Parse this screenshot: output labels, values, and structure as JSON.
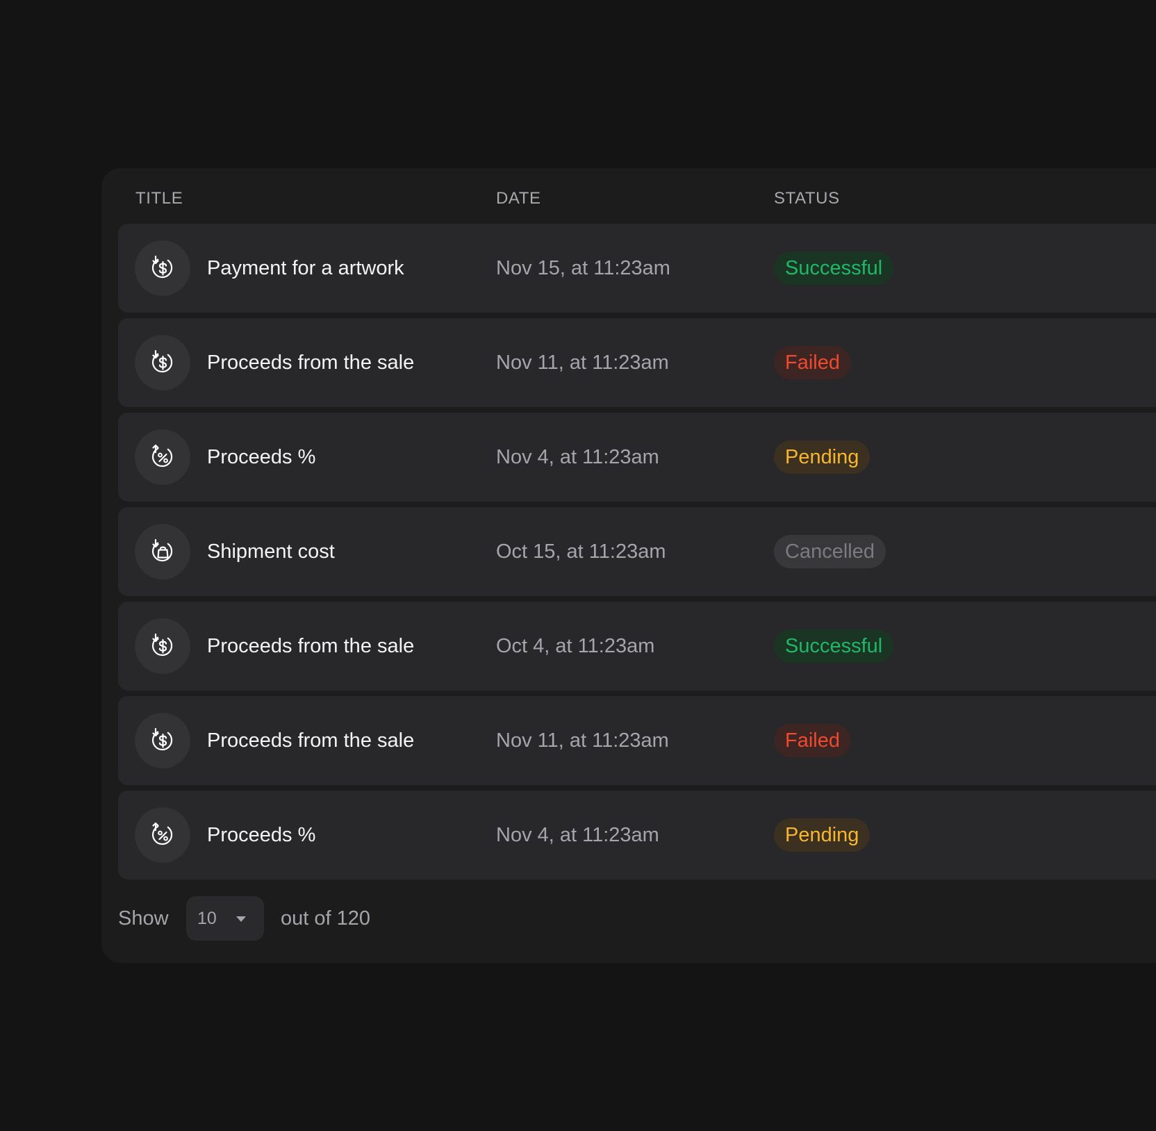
{
  "table": {
    "columns": {
      "title": "TITLE",
      "date": "DATE",
      "status": "STATUS"
    },
    "rows": [
      {
        "icon": "dollar-cycle-icon",
        "title": "Payment for a artwork",
        "date": "Nov 15, at 11:23am",
        "status": "Successful",
        "status_type": "success"
      },
      {
        "icon": "dollar-cycle-icon",
        "title": "Proceeds from the sale",
        "date": "Nov 11, at 11:23am",
        "status": "Failed",
        "status_type": "failed"
      },
      {
        "icon": "percent-cycle-icon",
        "title": "Proceeds %",
        "date": "Nov 4, at 11:23am",
        "status": "Pending",
        "status_type": "pending"
      },
      {
        "icon": "bag-cycle-icon",
        "title": "Shipment cost",
        "date": "Oct 15, at 11:23am",
        "status": "Cancelled",
        "status_type": "cancelled"
      },
      {
        "icon": "dollar-cycle-icon",
        "title": "Proceeds from the sale",
        "date": "Oct 4, at 11:23am",
        "status": "Successful",
        "status_type": "success"
      },
      {
        "icon": "dollar-cycle-icon",
        "title": "Proceeds from the sale",
        "date": "Nov 11, at 11:23am",
        "status": "Failed",
        "status_type": "failed"
      },
      {
        "icon": "percent-cycle-icon",
        "title": "Proceeds %",
        "date": "Nov 4, at 11:23am",
        "status": "Pending",
        "status_type": "pending"
      }
    ]
  },
  "footer": {
    "show_label": "Show",
    "page_size": "10",
    "total_label": "out of 120"
  },
  "colors": {
    "background": "#141414",
    "panel": "#1c1c1d",
    "row": "#28282a",
    "success": "#1fb866",
    "failed": "#f0492e",
    "pending": "#f7b62c",
    "cancelled": "#7b7b80"
  }
}
